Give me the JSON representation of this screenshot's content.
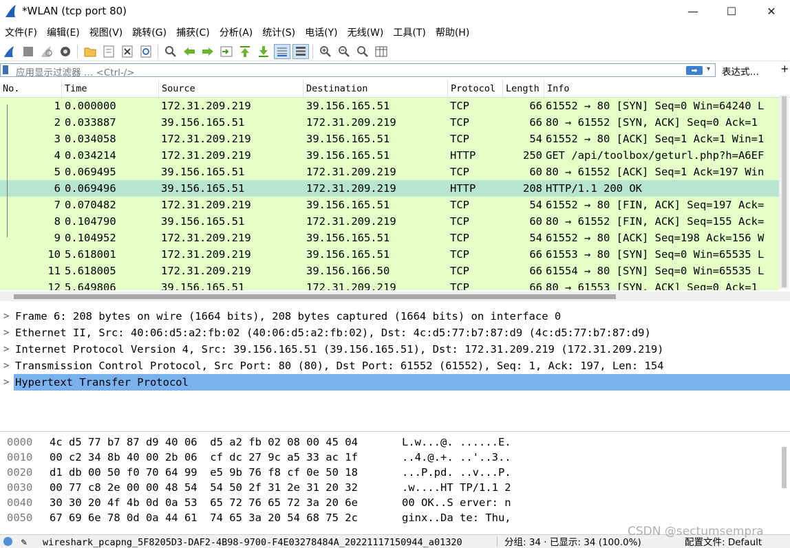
{
  "window": {
    "title": "*WLAN (tcp port 80)",
    "minimize_label": "—",
    "maximize_label": "☐",
    "close_label": "✕"
  },
  "menu": [
    "文件(F)",
    "编辑(E)",
    "视图(V)",
    "跳转(G)",
    "捕获(C)",
    "分析(A)",
    "统计(S)",
    "电话(Y)",
    "无线(W)",
    "工具(T)",
    "帮助(H)"
  ],
  "toolbar_icons": [
    "start-capture-icon",
    "stop-capture-icon",
    "restart-capture-icon",
    "capture-options-icon",
    "open-file-icon",
    "save-file-icon",
    "close-file-icon",
    "reload-file-icon",
    "find-packet-icon",
    "go-back-icon",
    "go-forward-icon",
    "go-to-packet-icon",
    "go-first-icon",
    "go-last-icon",
    "autoscroll-icon",
    "colorize-icon",
    "zoom-in-icon",
    "zoom-out-icon",
    "zoom-normal-icon",
    "resize-columns-icon"
  ],
  "filter": {
    "placeholder": "应用显示过滤器 … <Ctrl-/>",
    "apply_label": "➡",
    "dropdown_label": "▾",
    "expression_label": "表达式…",
    "plus_label": "+"
  },
  "packet_list": {
    "columns": [
      "No.",
      "Time",
      "Source",
      "Destination",
      "Protocol",
      "Length",
      "Info"
    ],
    "rows": [
      {
        "no": "1",
        "time": "0.000000",
        "src": "172.31.209.219",
        "dst": "39.156.165.51",
        "proto": "TCP",
        "len": "66",
        "info": "61552 → 80 [SYN] Seq=0 Win=64240 L"
      },
      {
        "no": "2",
        "time": "0.033887",
        "src": "39.156.165.51",
        "dst": "172.31.209.219",
        "proto": "TCP",
        "len": "66",
        "info": "80 → 61552 [SYN, ACK] Seq=0 Ack=1"
      },
      {
        "no": "3",
        "time": "0.034058",
        "src": "172.31.209.219",
        "dst": "39.156.165.51",
        "proto": "TCP",
        "len": "54",
        "info": "61552 → 80 [ACK] Seq=1 Ack=1 Win=1"
      },
      {
        "no": "4",
        "time": "0.034214",
        "src": "172.31.209.219",
        "dst": "39.156.165.51",
        "proto": "HTTP",
        "len": "250",
        "info": "GET /api/toolbox/geturl.php?h=A6EF"
      },
      {
        "no": "5",
        "time": "0.069495",
        "src": "39.156.165.51",
        "dst": "172.31.209.219",
        "proto": "TCP",
        "len": "60",
        "info": "80 → 61552 [ACK] Seq=1 Ack=197 Win"
      },
      {
        "no": "6",
        "time": "0.069496",
        "src": "39.156.165.51",
        "dst": "172.31.209.219",
        "proto": "HTTP",
        "len": "208",
        "info": "HTTP/1.1 200 OK",
        "selected": true
      },
      {
        "no": "7",
        "time": "0.070482",
        "src": "172.31.209.219",
        "dst": "39.156.165.51",
        "proto": "TCP",
        "len": "54",
        "info": "61552 → 80 [FIN, ACK] Seq=197 Ack="
      },
      {
        "no": "8",
        "time": "0.104790",
        "src": "39.156.165.51",
        "dst": "172.31.209.219",
        "proto": "TCP",
        "len": "60",
        "info": "80 → 61552 [FIN, ACK] Seq=155 Ack="
      },
      {
        "no": "9",
        "time": "0.104952",
        "src": "172.31.209.219",
        "dst": "39.156.165.51",
        "proto": "TCP",
        "len": "54",
        "info": "61552 → 80 [ACK] Seq=198 Ack=156 W"
      },
      {
        "no": "10",
        "time": "5.618001",
        "src": "172.31.209.219",
        "dst": "39.156.165.51",
        "proto": "TCP",
        "len": "66",
        "info": "61553 → 80 [SYN] Seq=0 Win=65535 L"
      },
      {
        "no": "11",
        "time": "5.618005",
        "src": "172.31.209.219",
        "dst": "39.156.166.50",
        "proto": "TCP",
        "len": "66",
        "info": "61554 → 80 [SYN] Seq=0 Win=65535 L"
      },
      {
        "no": "12",
        "time": "5.649806",
        "src": "39.156.165.51",
        "dst": "172.31.209.219",
        "proto": "TCP",
        "len": "66",
        "info": "80 → 61553 [SYN, ACK] Seq=0 Ack=1"
      }
    ]
  },
  "details": [
    {
      "text": "Frame 6: 208 bytes on wire (1664 bits), 208 bytes captured (1664 bits) on interface 0"
    },
    {
      "text": "Ethernet II, Src: 40:06:d5:a2:fb:02 (40:06:d5:a2:fb:02), Dst: 4c:d5:77:b7:87:d9 (4c:d5:77:b7:87:d9)"
    },
    {
      "text": "Internet Protocol Version 4, Src: 39.156.165.51 (39.156.165.51), Dst: 172.31.209.219 (172.31.209.219)"
    },
    {
      "text": "Transmission Control Protocol, Src Port: 80 (80), Dst Port: 61552 (61552), Seq: 1, Ack: 197, Len: 154"
    },
    {
      "text": "Hypertext Transfer Protocol",
      "selected": true
    }
  ],
  "expand_arrow": ">",
  "hex": [
    {
      "off": "0000",
      "bytes": "4c d5 77 b7 87 d9 40 06  d5 a2 fb 02 08 00 45 04",
      "ascii": "L.w...@. ......E."
    },
    {
      "off": "0010",
      "bytes": "00 c2 34 8b 40 00 2b 06  cf dc 27 9c a5 33 ac 1f",
      "ascii": "..4.@.+. ..'..3.."
    },
    {
      "off": "0020",
      "bytes": "d1 db 00 50 f0 70 64 99  e5 9b 76 f8 cf 0e 50 18",
      "ascii": "...P.pd. ..v...P."
    },
    {
      "off": "0030",
      "bytes": "00 77 c8 2e 00 00 48 54  54 50 2f 31 2e 31 20 32",
      "ascii": ".w....HT TP/1.1 2"
    },
    {
      "off": "0040",
      "bytes": "30 30 20 4f 4b 0d 0a 53  65 72 76 65 72 3a 20 6e",
      "ascii": "00 OK..S erver: n"
    },
    {
      "off": "0050",
      "bytes": "67 69 6e 78 0d 0a 44 61  74 65 3a 20 54 68 75 2c",
      "ascii": "ginx..Da te: Thu,"
    }
  ],
  "status": {
    "file": "wireshark_pcapng_5F8205D3-DAF2-4B98-9700-F4E03278484A_20221117150944_a01320",
    "packets": "分组: 34 · 已显示: 34 (100.0%)",
    "profile": "配置文件: Default",
    "edit_icon": "✎"
  },
  "watermark": "CSDN @sectumsempra",
  "colors": {
    "tcp_row": "#e4ffc7",
    "selected_row": "#b8e4d2",
    "selected_detail": "#7ab2ef",
    "accent": "#3b6fb5"
  }
}
